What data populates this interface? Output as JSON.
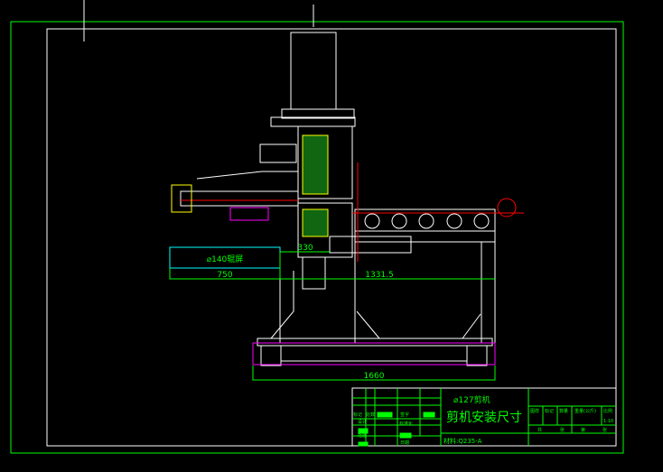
{
  "drawing": {
    "dimensions": {
      "d330": "330",
      "d750": "750",
      "d1331": "1331.5",
      "d1660": "1660"
    },
    "callout": "⌀140辊屏",
    "title_block": {
      "product": "⌀127剪机",
      "title": "剪机安装尺寸",
      "material": "材料:Q235-A",
      "labels": {
        "mark": "标记",
        "count": "处数",
        "sign": "签字",
        "design": "设计",
        "standard": "标准化",
        "trace": "描图",
        "date": "日期",
        "stage": "图样",
        "stage_mark": "标记",
        "quantity": "数量",
        "weight": "重量(公斤)",
        "scale": "比例",
        "total": "共",
        "sheet": "张",
        "no": "第",
        "sheet2": "张"
      },
      "scale_value": "1:10"
    },
    "colors": {
      "frame": "#ffffff",
      "line": "#00ff00",
      "accent": "#ff0000",
      "cyan": "#00ffff",
      "magenta": "#ff00ff",
      "yellow": "#ffff00"
    }
  }
}
